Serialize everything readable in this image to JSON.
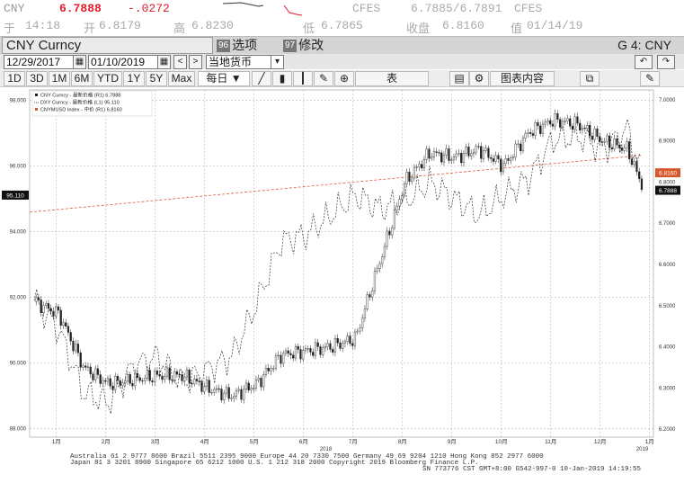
{
  "quote_line1": {
    "ticker": "CNY",
    "last": "6.7888",
    "change": "-.0272",
    "source": "CFES",
    "bid_ask": "6.7885/6.7891",
    "source2": "CFES"
  },
  "quote_line2": {
    "time_label": "于",
    "time": "14:18",
    "open_label": "开",
    "open": "6.8179",
    "high_label": "高",
    "high": "6.8230",
    "low_label": "低",
    "low": "6.7865",
    "close_label": "收盘",
    "close": "6.8160",
    "date_label": "值",
    "date": "01/14/19"
  },
  "titlebar": {
    "security": "CNY Curncy",
    "menu1_num": "96",
    "menu1": "选项",
    "menu2_num": "97",
    "menu2": "修改",
    "function": "G 4: CNY"
  },
  "controls": {
    "start_date": "12/29/2017",
    "end_date": "01/10/2019",
    "currency": "当地货币"
  },
  "toolbar": {
    "periods": [
      "1D",
      "3D",
      "1M",
      "6M",
      "YTD",
      "1Y",
      "5Y",
      "Max"
    ],
    "daily": "每日 ▼",
    "table": "表",
    "chart_content": "图表内容"
  },
  "chart_data": {
    "type": "line",
    "legend": [
      {
        "name": "CNY Curncy - 最新价格 (R1) 6.7888",
        "style": "candle"
      },
      {
        "name": "DXY Curncy - 最新价格 (L1) 95.110",
        "style": "dashed"
      },
      {
        "name": "CNYMUSD Index - 中价 (R1) 6.8160",
        "style": "red-dashed"
      }
    ],
    "x_labels": [
      "1月",
      "2月",
      "3月",
      "4月",
      "5月",
      "6月",
      "7月",
      "8月",
      "9月",
      "10月",
      "11月",
      "12月",
      "1月"
    ],
    "year_labels": [
      "2018",
      "2019"
    ],
    "left_axis": {
      "ticks": [
        "98.000",
        "96.000",
        "94.000",
        "92.000",
        "90.000",
        "88.000"
      ],
      "range": [
        87.8,
        98.2
      ]
    },
    "right_axis": {
      "ticks": [
        "7.0000",
        "6.9000",
        "6.8000",
        "6.7000",
        "6.6000",
        "6.5000",
        "6.4000",
        "6.3000",
        "6.2000"
      ],
      "range": [
        6.185,
        7.015
      ]
    },
    "left_value_label": "95.110",
    "right_value_labels": [
      "6.8160",
      "6.7888"
    ],
    "series": [
      {
        "name": "CNY Curncy",
        "axis": "right",
        "x": [
          0,
          0.5,
          1,
          1.5,
          2,
          2.5,
          3,
          3.5,
          4,
          4.5,
          5,
          5.5,
          6,
          6.5,
          7,
          7.5,
          8,
          8.5,
          9,
          9.5,
          10,
          10.5,
          11,
          11.5,
          12,
          12.3
        ],
        "y": [
          6.51,
          6.48,
          6.35,
          6.31,
          6.32,
          6.33,
          6.33,
          6.3,
          6.28,
          6.31,
          6.38,
          6.39,
          6.4,
          6.42,
          6.61,
          6.8,
          6.87,
          6.86,
          6.88,
          6.84,
          6.92,
          6.95,
          6.94,
          6.9,
          6.88,
          6.79
        ]
      },
      {
        "name": "DXY Curncy",
        "axis": "left",
        "x": [
          0,
          0.5,
          1,
          1.5,
          2,
          2.5,
          3,
          3.5,
          4,
          4.5,
          5,
          5.5,
          6,
          6.5,
          7,
          7.5,
          8,
          8.5,
          9,
          9.5,
          10,
          10.5,
          11,
          11.5,
          12,
          12.3
        ],
        "y": [
          91.9,
          91.0,
          89.1,
          88.8,
          89.9,
          90.2,
          89.4,
          89.8,
          90.2,
          91.8,
          93.7,
          93.9,
          94.5,
          95.1,
          94.7,
          94.9,
          95.5,
          95.0,
          94.5,
          95.1,
          95.6,
          96.8,
          96.9,
          96.5,
          97.1,
          95.8
        ]
      },
      {
        "name": "CNYMUSD Index",
        "axis": "right",
        "x": [
          0,
          12.3
        ],
        "y": [
          6.727,
          6.865
        ]
      }
    ]
  },
  "footer": {
    "line1": "Australia 61 2 9777 8600  Brazil 5511 2395 9000  Europe 44 20 7330 7500  Germany 49 69 9204 1210  Hong Kong 852 2977 6000",
    "line2": "Japan 81 3 3201 8900        Singapore 65 6212 1000      U.S. 1 212 318 2000        Copyright 2019 Bloomberg Finance L.P.",
    "line3": "SN 773776 CST  GMT+8:00 G542-997-0 10-Jan-2019 14:19:55"
  }
}
